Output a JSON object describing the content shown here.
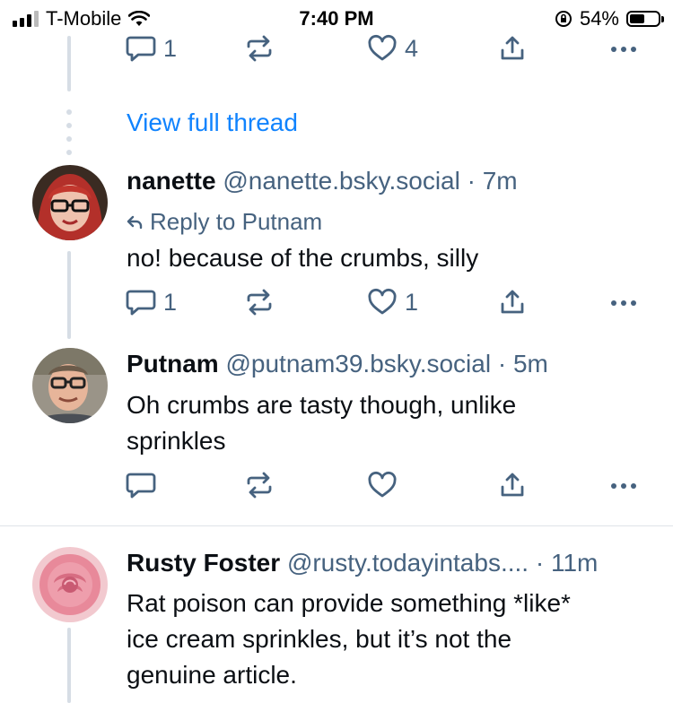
{
  "status_bar": {
    "carrier": "T-Mobile",
    "time": "7:40 PM",
    "battery": "54%",
    "battery_level": 0.54,
    "signal_bars_active": 3
  },
  "top_actions": {
    "reply_count": "1",
    "like_count": "4"
  },
  "view_full_thread": "View full thread",
  "posts": [
    {
      "name": "nanette",
      "handle": "@nanette.bsky.social",
      "time": "· 7m",
      "reply_to": "Reply to Putnam",
      "text": "no! because of the crumbs, silly",
      "reply_count": "1",
      "like_count": "1"
    },
    {
      "name": "Putnam",
      "handle": "@putnam39.bsky.social",
      "time": "· 5m",
      "text_lines": [
        "Oh crumbs are tasty though, unlike",
        "sprinkles"
      ]
    },
    {
      "name": "Rusty Foster",
      "handle": "@rusty.todayintabs....",
      "time": "· 11m",
      "text_lines": [
        "Rat poison can provide something *like*",
        "ice cream sprinkles, but it’s not the",
        "genuine article."
      ]
    }
  ],
  "colors": {
    "accent": "#1083fe",
    "muted": "#46627f",
    "thread_line": "#d6dde5"
  },
  "icons": [
    "reply-icon",
    "repost-icon",
    "like-icon",
    "share-icon",
    "more-icon",
    "reply-arrow-icon",
    "wifi-icon",
    "orientation-lock-icon",
    "battery-icon",
    "signal-icon"
  ]
}
